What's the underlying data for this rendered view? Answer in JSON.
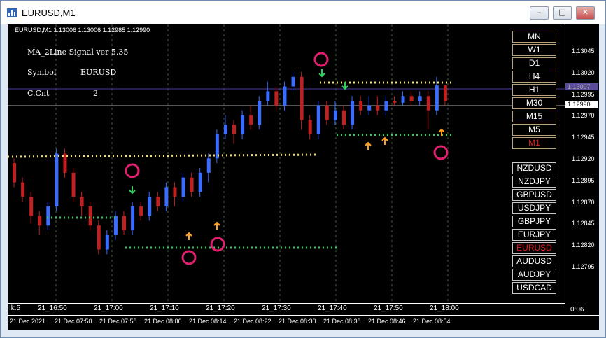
{
  "window": {
    "title": "EURUSD,M1"
  },
  "chart": {
    "ohlc_text": "EURUSD,M1  1.13006 1.13006 1.12985 1.12990",
    "indicator": {
      "name": "MA_2Line Signal ver 5.35",
      "symbol_label": "Symbol",
      "symbol_value": "EURUSD",
      "count_label": "C.Cnt",
      "count_value": "2"
    },
    "timeframes": [
      "MN",
      "W1",
      "D1",
      "H4",
      "H1",
      "M30",
      "M15",
      "M5",
      "M1"
    ],
    "active_timeframe": "M1",
    "symbols": [
      "NZDUSD",
      "NZDJPY",
      "GBPUSD",
      "USDJPY",
      "GBPJPY",
      "EURJPY",
      "EURUSD",
      "AUDUSD",
      "AUDJPY",
      "USDCAD"
    ],
    "active_symbol": "EURUSD",
    "price_labels": [
      "1.13045",
      "1.13020",
      "1.12995",
      "1.12970",
      "1.12945",
      "1.12920",
      "1.12895",
      "1.12870",
      "1.12845",
      "1.12820",
      "1.12795"
    ],
    "current_price_tags": [
      "1.13007",
      "1.12990"
    ],
    "time_labels": [
      "21_16:50",
      "21_17:00",
      "21_17:10",
      "21_17:20",
      "21_17:30",
      "21_17:40",
      "21_17:50",
      "21_18:00"
    ],
    "date_labels": [
      "21 Dec 2021",
      "21 Dec 07:50",
      "21 Dec 07:58",
      "21 Dec 08:06",
      "21 Dec 08:14",
      "21 Dec 08:22",
      "21 Dec 08:30",
      "21 Dec 08:38",
      "21 Dec 08:46",
      "21 Dec 08:54"
    ],
    "corner_left": "Ik.5",
    "corner_right": "0:06",
    "colors": {
      "up_candle": "#3a6cff",
      "down_candle": "#c02020",
      "signal_up": "#ffa020",
      "signal_down": "#30d060",
      "circle": "#e0206f",
      "resistance": "#f0e060",
      "support": "#30d060"
    }
  }
}
